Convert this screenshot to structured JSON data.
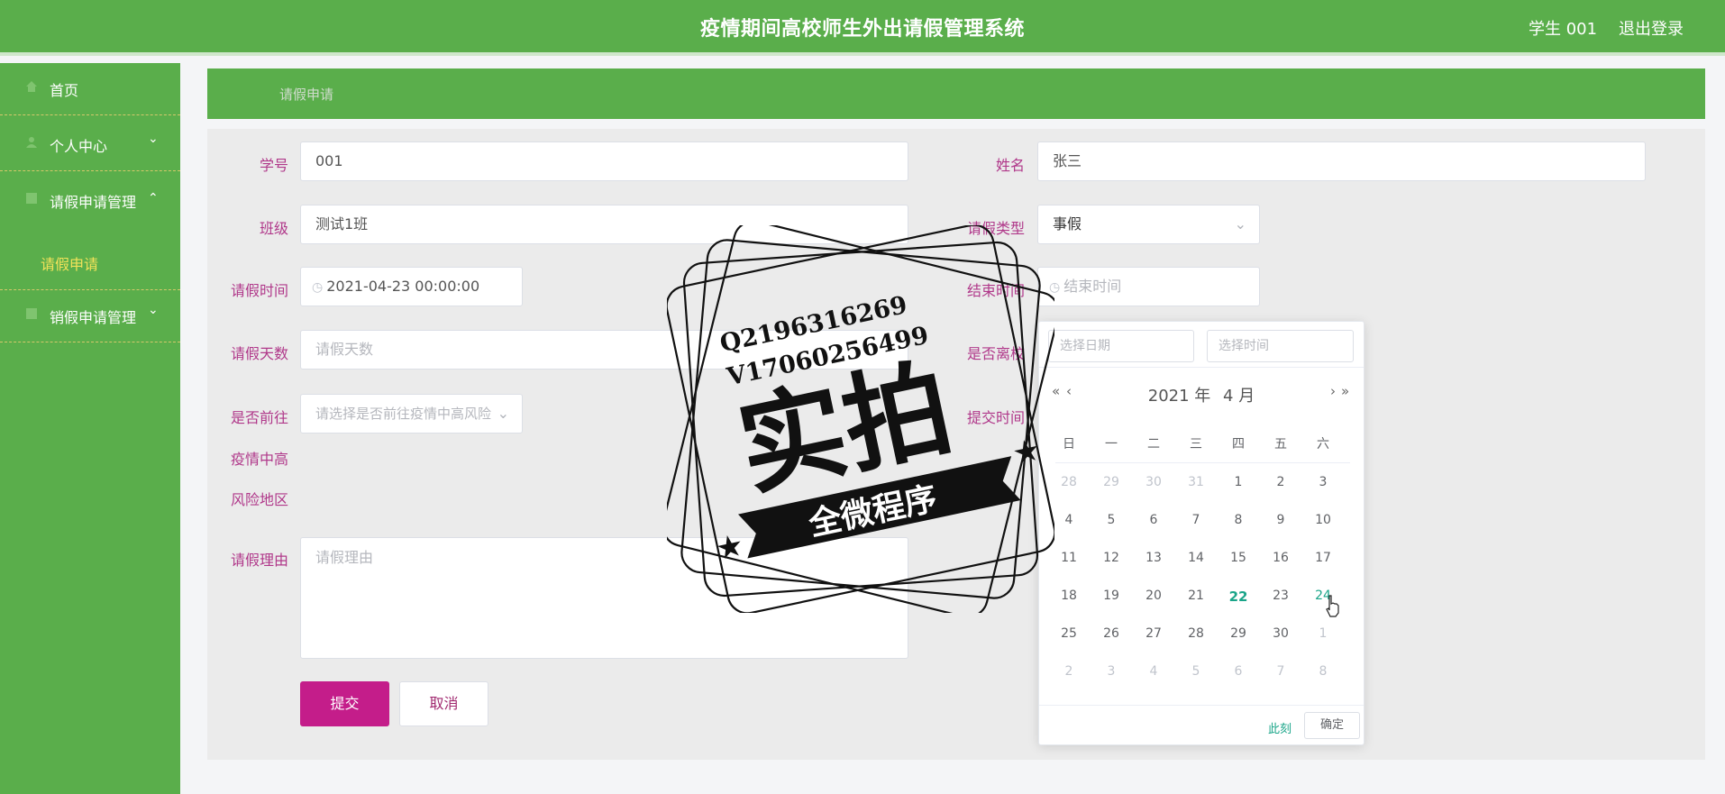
{
  "header": {
    "title": "疫情期间高校师生外出请假管理系统",
    "user": "学生 001",
    "logout": "退出登录"
  },
  "sidebar": {
    "items": [
      {
        "label": "首页",
        "icon": "home-icon"
      },
      {
        "label": "个人中心",
        "icon": "user-icon"
      },
      {
        "label": "请假申请管理",
        "icon": "list-icon"
      },
      {
        "label": "销假申请管理",
        "icon": "list-icon"
      }
    ],
    "subitem": "请假申请"
  },
  "breadcrumb": "请假申请",
  "form": {
    "student_id": {
      "label": "学号",
      "value": "001"
    },
    "name": {
      "label": "姓名",
      "value": "张三"
    },
    "class": {
      "label": "班级",
      "value": "测试1班"
    },
    "leave_type": {
      "label": "请假类型",
      "value": "事假"
    },
    "leave_time": {
      "label": "请假时间",
      "value": "2021-04-23 00:00:00"
    },
    "end_time": {
      "label": "结束时间",
      "placeholder": "结束时间"
    },
    "days": {
      "label": "请假天数",
      "placeholder": "请假天数"
    },
    "is_school": {
      "label": "是否离校"
    },
    "go_risk": {
      "label": "是否前往",
      "placeholder": "请选择是否前往疫情中高风险"
    },
    "submit_time": {
      "label": "提交时间"
    },
    "risk_area": {
      "label1": "疫情中高",
      "label2": "风险地区"
    },
    "reason": {
      "label": "请假理由",
      "placeholder": "请假理由"
    },
    "submit": "提交",
    "cancel": "取消"
  },
  "picker": {
    "date_placeholder": "选择日期",
    "time_placeholder": "选择时间",
    "year": "2021 年",
    "month": "4 月",
    "weekdays": [
      "日",
      "一",
      "二",
      "三",
      "四",
      "五",
      "六"
    ],
    "weeks": [
      [
        "28",
        "29",
        "30",
        "31",
        "1",
        "2",
        "3"
      ],
      [
        "4",
        "5",
        "6",
        "7",
        "8",
        "9",
        "10"
      ],
      [
        "11",
        "12",
        "13",
        "14",
        "15",
        "16",
        "17"
      ],
      [
        "18",
        "19",
        "20",
        "21",
        "22",
        "23",
        "24"
      ],
      [
        "25",
        "26",
        "27",
        "28",
        "29",
        "30",
        "1"
      ],
      [
        "2",
        "3",
        "4",
        "5",
        "6",
        "7",
        "8"
      ]
    ],
    "today": "22",
    "now": "此刻",
    "confirm": "确定"
  },
  "stamp": {
    "line1": "Q2196316269",
    "line2": "V17060256499",
    "big": "实拍",
    "ribbon": "全微程序"
  },
  "colors": {
    "primary": "#5aae4b",
    "accent": "#c41d8a",
    "label": "#b0388a"
  }
}
